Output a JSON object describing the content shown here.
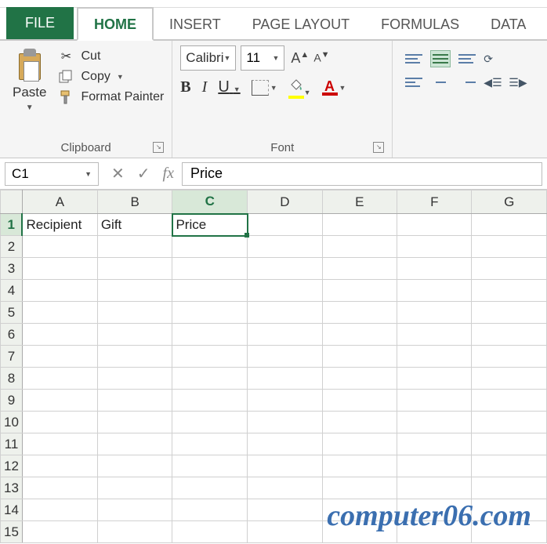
{
  "tabs": {
    "file": "FILE",
    "home": "HOME",
    "insert": "INSERT",
    "page_layout": "PAGE LAYOUT",
    "formulas": "FORMULAS",
    "data": "DATA"
  },
  "clipboard": {
    "paste": "Paste",
    "cut": "Cut",
    "copy": "Copy",
    "format_painter": "Format Painter",
    "group_label": "Clipboard"
  },
  "font": {
    "name": "Calibri",
    "size": "11",
    "bold": "B",
    "italic": "I",
    "underline": "U",
    "font_color_letter": "A",
    "grow": "A",
    "shrink": "A",
    "group_label": "Font"
  },
  "namebox": {
    "value": "C1"
  },
  "formula_bar": {
    "fx": "fx",
    "cancel": "✕",
    "enter": "✓",
    "value": "Price"
  },
  "columns": [
    "A",
    "B",
    "C",
    "D",
    "E",
    "F",
    "G"
  ],
  "rows": [
    "1",
    "2",
    "3",
    "4",
    "5",
    "6",
    "7",
    "8",
    "9",
    "10",
    "11",
    "12",
    "13",
    "14",
    "15"
  ],
  "selected_cell": {
    "col": "C",
    "row": "1"
  },
  "cells": {
    "A1": "Recipient",
    "B1": "Gift",
    "C1": "Price"
  },
  "watermark": "computer06.com"
}
